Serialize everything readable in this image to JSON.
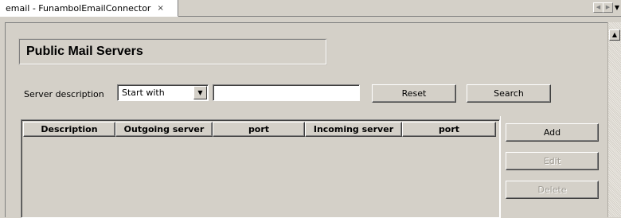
{
  "tab": {
    "title": "email - FunambolEmailConnector",
    "close_glyph": "×"
  },
  "tab_nav": {
    "left_icon": "chevron-left-icon",
    "right_icon": "chevron-right-icon",
    "menu_icon": "chevron-down-icon"
  },
  "page": {
    "title": "Public Mail Servers"
  },
  "filter": {
    "label": "Server description",
    "mode_value": "Start with",
    "text_value": "",
    "reset_label": "Reset",
    "search_label": "Search"
  },
  "table": {
    "columns": [
      "Description",
      "Outgoing server",
      "port",
      "Incoming server",
      "port"
    ],
    "rows": []
  },
  "actions": {
    "add_label": "Add",
    "edit_label": "Edit",
    "delete_label": "Delete"
  }
}
